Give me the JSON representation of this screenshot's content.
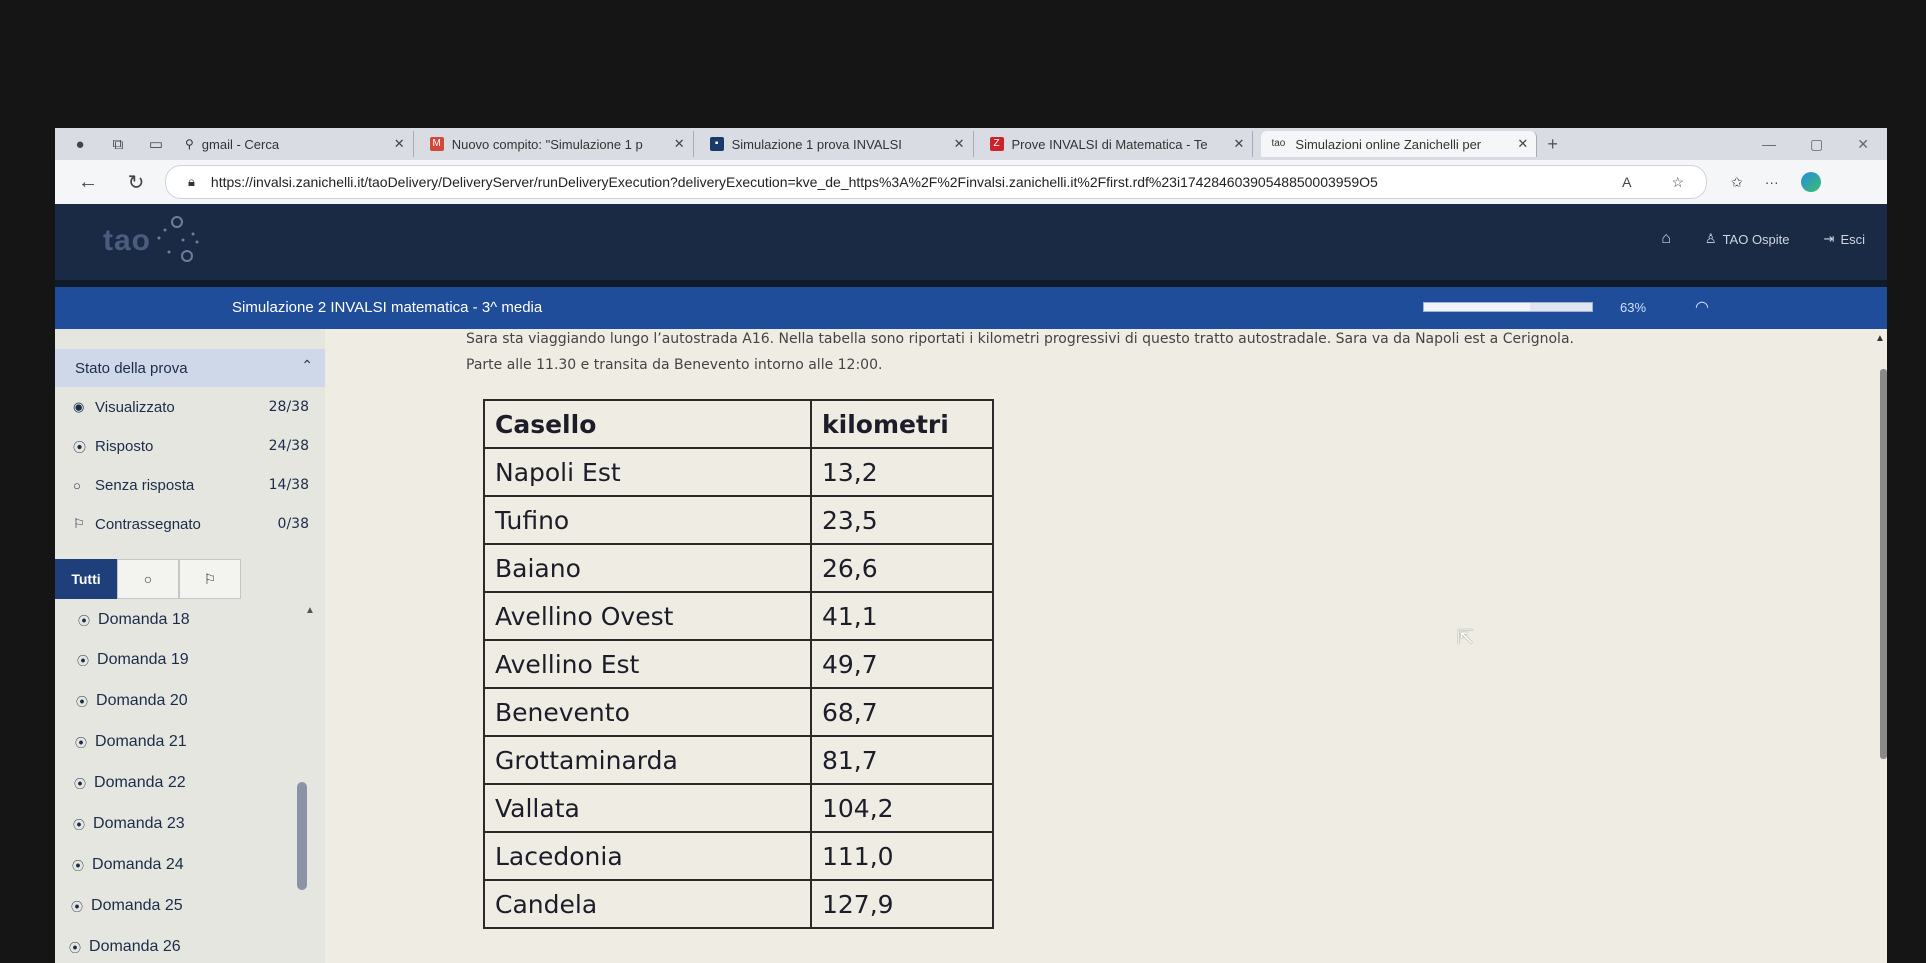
{
  "browser": {
    "tabs": [
      {
        "label": "gmail - Cerca",
        "icon": "search-icon"
      },
      {
        "label": "Nuovo compito: \"Simulazione 1 p",
        "icon": "gmail-icon"
      },
      {
        "label": "Simulazione 1 prova INVALSI",
        "icon": "classroom-icon"
      },
      {
        "label": "Prove INVALSI di Matematica - Te",
        "icon": "zanichelli-icon"
      },
      {
        "label": "Simulazioni online Zanichelli per",
        "icon": "tao-icon"
      }
    ],
    "url": "https://invalsi.zanichelli.it/taoDelivery/DeliveryServer/runDeliveryExecution?deliveryExecution=kve_de_https%3A%2F%2Finvalsi.zanichelli.it%2Ffirst.rdf%23i17428460390548850003959O5"
  },
  "header": {
    "logo": "tao",
    "user": "TAO Ospite",
    "logout": "Esci"
  },
  "titlebar": {
    "title": "Simulazione 2 INVALSI matematica - 3^ media",
    "progress_percent": 63,
    "progress_label": "63%"
  },
  "sidebar": {
    "stato_label": "Stato della prova",
    "stats": [
      {
        "label": "Visualizzato",
        "count": "28/38"
      },
      {
        "label": "Risposto",
        "count": "24/38"
      },
      {
        "label": "Senza risposta",
        "count": "14/38"
      },
      {
        "label": "Contrassegnato",
        "count": "0/38"
      }
    ],
    "filters": {
      "all": "Tutti"
    },
    "questions": [
      "Domanda 18",
      "Domanda 19",
      "Domanda 20",
      "Domanda 21",
      "Domanda 22",
      "Domanda 23",
      "Domanda 24",
      "Domanda 25",
      "Domanda 26"
    ]
  },
  "main": {
    "question_line1": "Sara sta viaggiando lungo l’autostrada A16. Nella tabella sono riportati i kilometri progressivi di questo tratto autostradale. Sara va da Napoli est a Cerignola.",
    "question_line2": "Parte alle 11.30 e transita da Benevento intorno alle 12:00.",
    "table": {
      "headers": [
        "Casello",
        "kilometri"
      ],
      "rows": [
        [
          "Napoli Est",
          "13,2"
        ],
        [
          "Tufino",
          "23,5"
        ],
        [
          "Baiano",
          "26,6"
        ],
        [
          "Avellino Ovest",
          "41,1"
        ],
        [
          "Avellino Est",
          "49,7"
        ],
        [
          "Benevento",
          "68,7"
        ],
        [
          "Grottaminarda",
          "81,7"
        ],
        [
          "Vallata",
          "104,2"
        ],
        [
          "Lacedonia",
          "111,0"
        ],
        [
          "Candela",
          "127,9"
        ]
      ]
    }
  }
}
